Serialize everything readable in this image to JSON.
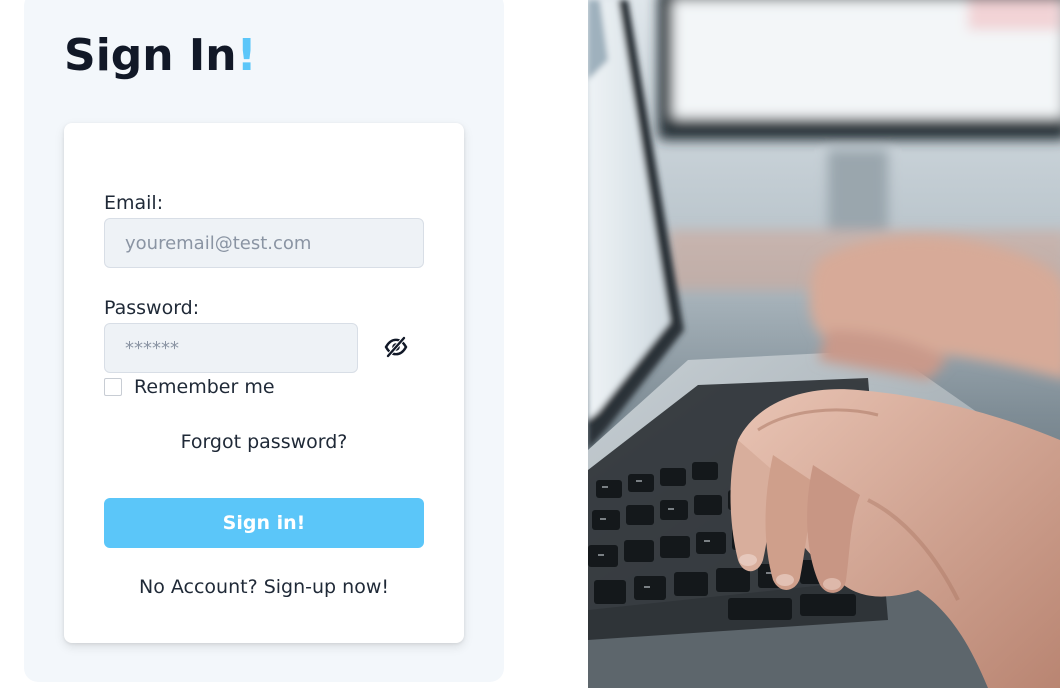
{
  "header": {
    "title": "Sign In",
    "title_accent": "!"
  },
  "form": {
    "email_label": "Email:",
    "email_placeholder": "youremail@test.com",
    "password_label": "Password:",
    "password_placeholder": "******",
    "password_toggle_icon": "eye-slash-icon",
    "remember_label": "Remember me",
    "remember_checked": false,
    "forgot_link": "Forgot password?",
    "submit_label": "Sign in!",
    "signup_link": "No Account? Sign-up now!"
  },
  "hero": {
    "image": "hands-typing-on-laptop-keyboard"
  },
  "colors": {
    "accent": "#5bc6f9",
    "panel_bg": "#f3f7fb",
    "input_bg": "#eef2f6",
    "text": "#1f2937"
  }
}
